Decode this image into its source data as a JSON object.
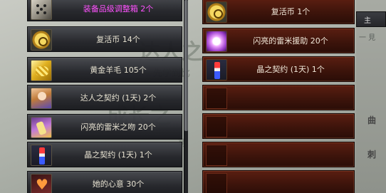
{
  "left_list": {
    "items": [
      {
        "label": "装备品级调整箱 2个",
        "icon": "dice-box-icon",
        "highlight": true
      },
      {
        "label": "复活币 14个",
        "icon": "revival-coin-icon",
        "highlight": false
      },
      {
        "label": "黄金羊毛 105个",
        "icon": "golden-wool-icon",
        "highlight": false
      },
      {
        "label": "达人之契约 (1天) 2个",
        "icon": "expert-contract-icon",
        "highlight": false
      },
      {
        "label": "闪亮的雷米之吻 20个",
        "icon": "remy-kiss-icon",
        "highlight": false
      },
      {
        "label": "晶之契约 (1天) 1个",
        "icon": "crystal-contract-icon",
        "highlight": false
      },
      {
        "label": "她的心意 30个",
        "icon": "heart-gift-icon",
        "highlight": false
      }
    ]
  },
  "right_list": {
    "items": [
      {
        "label": "复活币 1个",
        "icon": "revival-coin-icon",
        "highlight": false
      },
      {
        "label": "闪亮的雷米援助 20个",
        "icon": "remy-aid-icon",
        "highlight": false
      },
      {
        "label": "晶之契约 (1天) 1个",
        "icon": "crystal-contract-icon",
        "highlight": false
      },
      {
        "label": "",
        "icon": "",
        "highlight": false
      },
      {
        "label": "",
        "icon": "",
        "highlight": false
      },
      {
        "label": "",
        "icon": "",
        "highlight": false
      },
      {
        "label": "",
        "icon": "",
        "highlight": false
      }
    ]
  },
  "background_text": {
    "wm1": "达人之",
    "wm2": "成长之",
    "wm3": "先学到比",
    "wm4": "可"
  },
  "edge_panel": {
    "tab_label": "主",
    "sub_label": "一 見",
    "text_1": "曲",
    "text_2": "刺"
  },
  "colors": {
    "purple_text": "#ff52ff",
    "item_text": "#e6e1d0",
    "reward_row": "#3d140b"
  }
}
